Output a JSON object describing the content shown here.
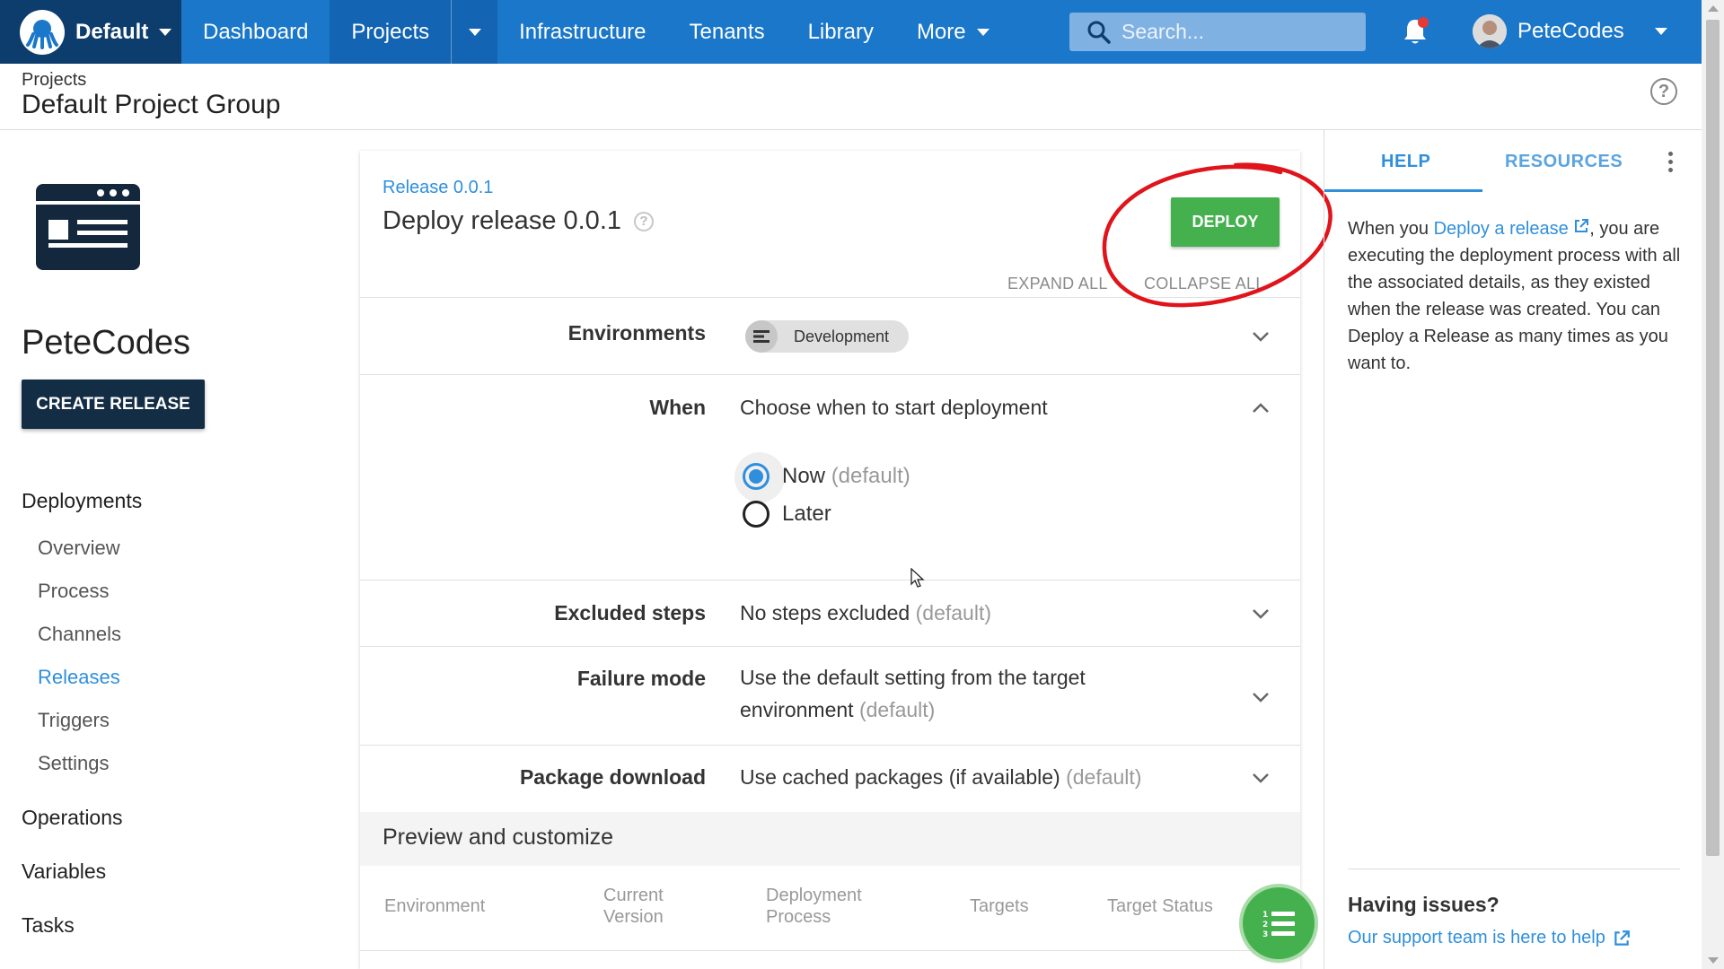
{
  "topnav": {
    "space_name": "Default",
    "links": [
      "Dashboard",
      "Projects",
      "Infrastructure",
      "Tenants",
      "Library",
      "More"
    ],
    "search_placeholder": "Search...",
    "user_name": "PeteCodes",
    "brand_color": "#1a77ca",
    "space_bg_color": "#0d3d6c"
  },
  "page_header": {
    "breadcrumb": "Projects",
    "title": "Default Project Group"
  },
  "sidebar": {
    "project_name": "PeteCodes",
    "create_release_label": "CREATE RELEASE",
    "deployments_label": "Deployments",
    "deployment_items": [
      "Overview",
      "Process",
      "Channels",
      "Releases",
      "Triggers",
      "Settings"
    ],
    "active_item": "Releases",
    "groups": [
      "Operations",
      "Variables",
      "Tasks"
    ]
  },
  "main": {
    "release_link": "Release 0.0.1",
    "title": "Deploy release 0.0.1",
    "deploy_label": "DEPLOY",
    "deploy_color": "#44b04e",
    "expand_all": "EXPAND ALL",
    "collapse_all": "COLLAPSE ALL",
    "rows": {
      "environments": {
        "label": "Environments",
        "chip": "Development"
      },
      "when": {
        "label": "When",
        "value": "Choose when to start deployment",
        "options": [
          {
            "label": "Now",
            "suffix": "(default)",
            "selected": true
          },
          {
            "label": "Later",
            "suffix": "",
            "selected": false
          }
        ]
      },
      "excluded": {
        "label": "Excluded steps",
        "value": "No steps excluded",
        "suffix": "(default)"
      },
      "failure": {
        "label": "Failure mode",
        "value_line1": "Use the default setting from the target",
        "value_line2": "environment",
        "suffix": "(default)"
      },
      "package": {
        "label": "Package download",
        "value": "Use cached packages (if available)",
        "suffix": "(default)"
      }
    },
    "preview_title": "Preview and customize",
    "table_headers": [
      "Environment",
      "Current Version",
      "Deployment Process",
      "Targets",
      "Target Status"
    ]
  },
  "help_panel": {
    "tabs": [
      "HELP",
      "RESOURCES"
    ],
    "active_tab": "HELP",
    "text_before_link": "When you ",
    "link_text": "Deploy a release",
    "text_after_link": ", you are executing the deployment process with all the associated details, as they existed when the release was created. You can Deploy a Release as many times as you want to.",
    "issues_title": "Having issues?",
    "issues_link": "Our support team is here to help"
  }
}
